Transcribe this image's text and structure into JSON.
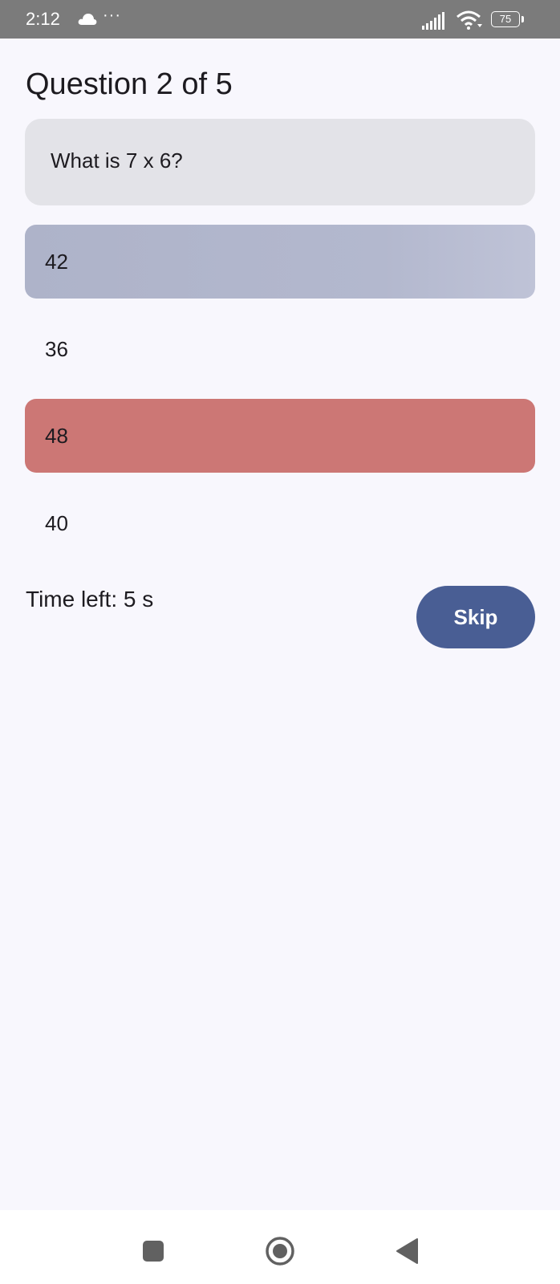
{
  "status_bar": {
    "time": "2:12",
    "more_indicator": "···",
    "battery_level": "75",
    "icons": [
      "cloud-icon",
      "signal-icon",
      "wifi-icon",
      "battery-icon"
    ],
    "background_color": "#7b7b7b"
  },
  "quiz": {
    "title": "Question 2 of 5",
    "question": "What is 7 x 6?",
    "answers": [
      {
        "label": "42",
        "state": "selected",
        "color": "#b0b5cb"
      },
      {
        "label": "36",
        "state": "default"
      },
      {
        "label": "48",
        "state": "wrong",
        "color": "#cc7775"
      },
      {
        "label": "40",
        "state": "default"
      }
    ],
    "timer_text": "Time left: 5 s",
    "skip_label": "Skip",
    "skip_color": "#495e94"
  },
  "nav_bar": {
    "icons": [
      "recents-square-icon",
      "home-circle-icon",
      "back-triangle-icon"
    ]
  }
}
